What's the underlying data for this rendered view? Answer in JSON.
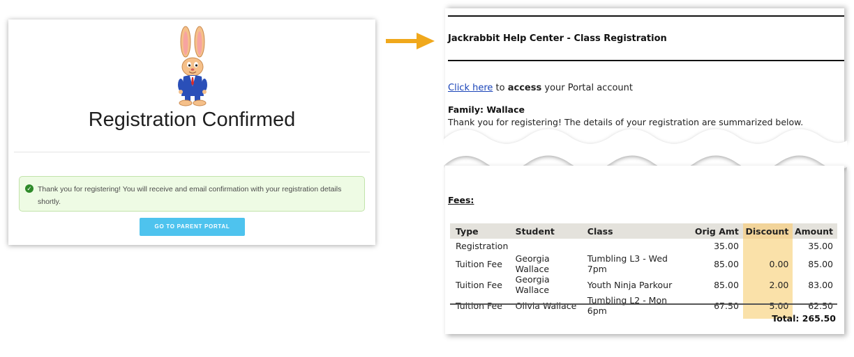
{
  "confirmation": {
    "title": "Registration Confirmed",
    "alert_text": "Thank you for registering! You will receive and email confirmation with your registration details shortly.",
    "portal_button": "GO TO PARENT PORTAL"
  },
  "email": {
    "header": "Jackrabbit Help Center - Class Registration",
    "link_text": "Click here",
    "access_pre": "to",
    "access_bold": "access",
    "access_post": "your Portal account",
    "family": "Family: Wallace",
    "thanks": "Thank you for registering! The details of your registration are summarized below.",
    "fees_label": "Fees:",
    "columns": [
      "Type",
      "Student",
      "Class",
      "Orig Amt",
      "Discount",
      "Amount"
    ],
    "rows": [
      [
        "Registration",
        "",
        "",
        "35.00",
        "",
        "35.00"
      ],
      [
        "Tuition Fee",
        "Georgia Wallace",
        "Tumbling L3 - Wed 7pm",
        "85.00",
        "0.00",
        "85.00"
      ],
      [
        "Tuition Fee",
        "Georgia Wallace",
        "Youth Ninja Parkour",
        "85.00",
        "2.00",
        "83.00"
      ],
      [
        "Tuition Fee",
        "Olivia Wallace",
        "Tumbling L2 - Mon 6pm",
        "67.50",
        "5.00",
        "62.50"
      ]
    ],
    "total": "Total: 265.50"
  },
  "colors": {
    "arrow": "#f0a81c",
    "button": "#4ec3ee",
    "alert_bg": "#eefbe4",
    "discount_highlight": "#fae1a9",
    "link": "#1a44b8"
  },
  "icons": {
    "alert": "check-circle-icon",
    "arrow": "arrow-right-icon",
    "mascot": "rabbit-mascot"
  }
}
